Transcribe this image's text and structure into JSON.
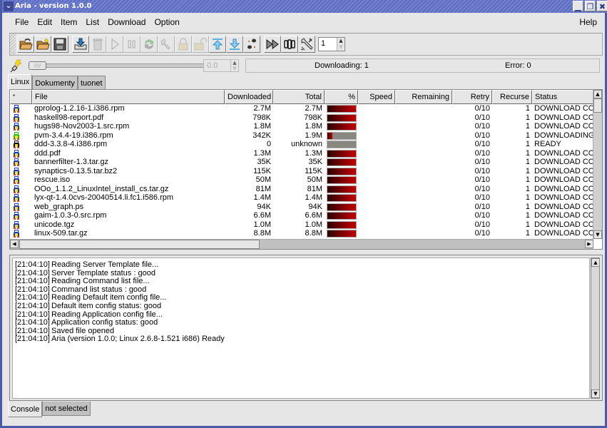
{
  "window": {
    "title": "Aria - version 1.0.0",
    "controls": [
      "minimize",
      "maximize",
      "close"
    ]
  },
  "menubar": {
    "items": [
      "File",
      "Edit",
      "Item",
      "List",
      "Download",
      "Option"
    ],
    "help": "Help"
  },
  "toolbar": {
    "buttons": [
      {
        "name": "open-file",
        "icon": "folder-open-icon",
        "enabled": true
      },
      {
        "name": "new-file",
        "icon": "folder-new-icon",
        "enabled": true
      },
      {
        "name": "save",
        "icon": "floppy-disk-icon",
        "enabled": true
      },
      {
        "name": "add-download",
        "icon": "inbox-download-icon",
        "enabled": true
      },
      {
        "name": "delete",
        "icon": "trash-icon",
        "enabled": false
      },
      {
        "name": "start",
        "icon": "play-icon",
        "enabled": false
      },
      {
        "name": "pause",
        "icon": "pause-icon",
        "enabled": false
      },
      {
        "name": "restart",
        "icon": "refresh-icon",
        "enabled": false
      },
      {
        "name": "settings",
        "icon": "wrench-icon",
        "enabled": false
      },
      {
        "name": "lock",
        "icon": "lock-closed-icon",
        "enabled": false
      },
      {
        "name": "unlock",
        "icon": "lock-open-icon",
        "enabled": false
      },
      {
        "name": "move-top",
        "icon": "arrow-up-top-icon",
        "enabled": true
      },
      {
        "name": "move-bottom",
        "icon": "arrow-down-bottom-icon",
        "enabled": true
      },
      {
        "name": "crawl",
        "icon": "footprints-icon",
        "enabled": true
      },
      {
        "name": "download-all",
        "icon": "fast-forward-icon",
        "enabled": true
      },
      {
        "name": "stop-all",
        "icon": "stop-all-icon",
        "enabled": true
      },
      {
        "name": "preferences",
        "icon": "tools-icon",
        "enabled": true
      }
    ],
    "thread_count": "1"
  },
  "speed": {
    "limit_value": "0.0",
    "slider_fraction": 0
  },
  "status": {
    "downloading": "Downloading: 1",
    "error": "Error: 0"
  },
  "tabs": [
    "Linux",
    "Dokumenty",
    "tuonet"
  ],
  "active_tab": "Linux",
  "table": {
    "columns": [
      "*",
      "File",
      "Downloaded",
      "Total",
      "%",
      "Speed",
      "Remaining",
      "Retry",
      "Recurse",
      "Status"
    ],
    "rows": [
      {
        "icon": "blue",
        "file": "gprolog-1.2.16-1.i386.rpm",
        "downloaded": "2.7M",
        "total": "2.7M",
        "percent": 100,
        "speed": "",
        "remaining": "",
        "retry": "0/10",
        "recurse": "1",
        "status": "DOWNLOAD CO"
      },
      {
        "icon": "blue",
        "file": "haskell98-report.pdf",
        "downloaded": "798K",
        "total": "798K",
        "percent": 100,
        "speed": "",
        "remaining": "",
        "retry": "0/10",
        "recurse": "1",
        "status": "DOWNLOAD CO"
      },
      {
        "icon": "blue",
        "file": "hugs98-Nov2003-1.src.rpm",
        "downloaded": "1.8M",
        "total": "1.8M",
        "percent": 100,
        "speed": "",
        "remaining": "",
        "retry": "0/10",
        "recurse": "1",
        "status": "DOWNLOAD CO"
      },
      {
        "icon": "green",
        "file": "pvm-3.4.4-19.i386.rpm",
        "downloaded": "342K",
        "total": "1.9M",
        "percent": 18,
        "speed": "",
        "remaining": "",
        "retry": "0/10",
        "recurse": "1",
        "status": "DOWNLOADING"
      },
      {
        "icon": "black",
        "file": "ddd-3.3.8-4.i386.rpm",
        "downloaded": "0",
        "total": "unknown",
        "percent": 0,
        "speed": "",
        "remaining": "",
        "retry": "0/10",
        "recurse": "1",
        "status": "READY"
      },
      {
        "icon": "blue",
        "file": "ddd.pdf",
        "downloaded": "1.3M",
        "total": "1.3M",
        "percent": 100,
        "speed": "",
        "remaining": "",
        "retry": "0/10",
        "recurse": "1",
        "status": "DOWNLOAD CO"
      },
      {
        "icon": "blue",
        "file": "bannerfilter-1.3.tar.gz",
        "downloaded": "35K",
        "total": "35K",
        "percent": 100,
        "speed": "",
        "remaining": "",
        "retry": "0/10",
        "recurse": "1",
        "status": "DOWNLOAD CO"
      },
      {
        "icon": "blue",
        "file": "synaptics-0.13.5.tar.bz2",
        "downloaded": "115K",
        "total": "115K",
        "percent": 100,
        "speed": "",
        "remaining": "",
        "retry": "0/10",
        "recurse": "1",
        "status": "DOWNLOAD CO"
      },
      {
        "icon": "blue",
        "file": "rescue.iso",
        "downloaded": "50M",
        "total": "50M",
        "percent": 100,
        "speed": "",
        "remaining": "",
        "retry": "0/10",
        "recurse": "1",
        "status": "DOWNLOAD CO"
      },
      {
        "icon": "blue",
        "file": "OOo_1.1.2_LinuxIntel_install_cs.tar.gz",
        "downloaded": "81M",
        "total": "81M",
        "percent": 100,
        "speed": "",
        "remaining": "",
        "retry": "0/10",
        "recurse": "1",
        "status": "DOWNLOAD CO"
      },
      {
        "icon": "blue",
        "file": "lyx-qt-1.4.0cvs-20040514.li.fc1.i586.rpm",
        "downloaded": "1.4M",
        "total": "1.4M",
        "percent": 100,
        "speed": "",
        "remaining": "",
        "retry": "0/10",
        "recurse": "1",
        "status": "DOWNLOAD CO"
      },
      {
        "icon": "blue",
        "file": "web_graph.ps",
        "downloaded": "94K",
        "total": "94K",
        "percent": 100,
        "speed": "",
        "remaining": "",
        "retry": "0/10",
        "recurse": "1",
        "status": "DOWNLOAD CO"
      },
      {
        "icon": "blue",
        "file": "gaim-1.0.3-0.src.rpm",
        "downloaded": "6.6M",
        "total": "6.6M",
        "percent": 100,
        "speed": "",
        "remaining": "",
        "retry": "0/10",
        "recurse": "1",
        "status": "DOWNLOAD CO"
      },
      {
        "icon": "blue",
        "file": "unicode.tgz",
        "downloaded": "1.0M",
        "total": "1.0M",
        "percent": 100,
        "speed": "",
        "remaining": "",
        "retry": "0/10",
        "recurse": "1",
        "status": "DOWNLOAD CO"
      },
      {
        "icon": "blue",
        "file": "linux-509.tar.gz",
        "downloaded": "8.8M",
        "total": "8.8M",
        "percent": 100,
        "speed": "",
        "remaining": "",
        "retry": "0/10",
        "recurse": "1",
        "status": "DOWNLOAD CO"
      }
    ]
  },
  "console": {
    "lines": [
      {
        "ts": "[21:04:10]",
        "msg": "Reading Server Template file..."
      },
      {
        "ts": "[21:04:10]",
        "msg": "Server Template status : good"
      },
      {
        "ts": "[21:04:10]",
        "msg": "Reading Command list file..."
      },
      {
        "ts": "[21:04:10]",
        "msg": "Command list status : good"
      },
      {
        "ts": "[21:04:10]",
        "msg": "Reading Default item config file..."
      },
      {
        "ts": "[21:04:10]",
        "msg": "Default item config status: good"
      },
      {
        "ts": "[21:04:10]",
        "msg": "Reading Application config file..."
      },
      {
        "ts": "[21:04:10]",
        "msg": "Application config status: good"
      },
      {
        "ts": "[21:04:10]",
        "msg": "Saved file opened"
      },
      {
        "ts": "[21:04:10]",
        "msg": "Aria (version 1.0.0; Linux 2.6.8-1.521 i686) Ready"
      }
    ]
  },
  "bottom_tabs": [
    "Console",
    "not selected"
  ],
  "colors": {
    "titlebar": "#6373c8",
    "progress_fill": "#c40000",
    "progress_empty": "#888780",
    "icon_complete": "#1a3ad0",
    "icon_downloading": "#20c020",
    "icon_ready": "#000000"
  }
}
